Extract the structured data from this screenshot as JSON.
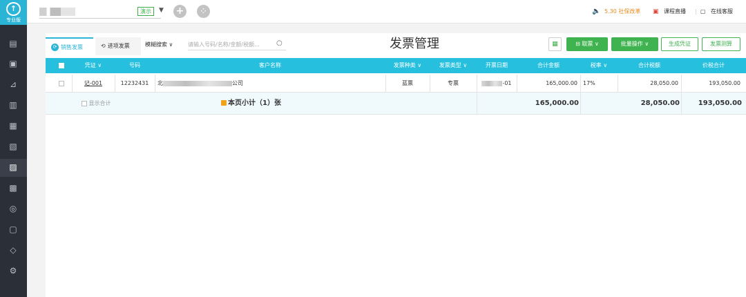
{
  "sidebar": {
    "edition": "专业版",
    "icons": [
      "voucher-icon",
      "ledger-icon",
      "report-icon",
      "assets-icon",
      "calculator-icon",
      "tax-icon",
      "invoice-icon",
      "bank-icon",
      "cashier-icon",
      "archive-icon",
      "check-icon",
      "settings-icon"
    ]
  },
  "topbar": {
    "demo_badge": "演示",
    "notice": "5.30 社保改革",
    "live_course": "课程直播",
    "online_service": "在线客服"
  },
  "tabs": {
    "sales": "销售发票",
    "purchase": "进项发票"
  },
  "search": {
    "mode": "模糊搜索",
    "placeholder": "请输入号码/名称/金额/税额..."
  },
  "page_title": "发票管理",
  "toolbar": {
    "fetch": "取票",
    "batch": "批量操作",
    "generate_voucher": "生成凭证",
    "tax_calc": "发票测算"
  },
  "table": {
    "headers": {
      "voucher": "凭证",
      "number": "号码",
      "customer": "客户名称",
      "invoice_kind": "发票种类",
      "invoice_type": "发票类型",
      "issue_date": "开票日期",
      "total_amount": "合计金额",
      "tax_rate": "税率",
      "total_tax": "合计税额",
      "total_with_tax": "价税合计"
    },
    "rows": [
      {
        "voucher": "记-001",
        "number": "12232431",
        "customer_prefix": "北",
        "customer_suffix": "公司",
        "invoice_kind": "蓝票",
        "invoice_type": "专票",
        "date_suffix": "-01",
        "total_amount": "165,000.00",
        "tax_rate": "17%",
        "total_tax": "28,050.00",
        "total_with_tax": "193,050.00"
      }
    ],
    "subtotal": {
      "show_total": "显示合计",
      "label": "本页小计（1）张",
      "total_amount": "165,000.00",
      "total_tax": "28,050.00",
      "total_with_tax": "193,050.00"
    }
  }
}
